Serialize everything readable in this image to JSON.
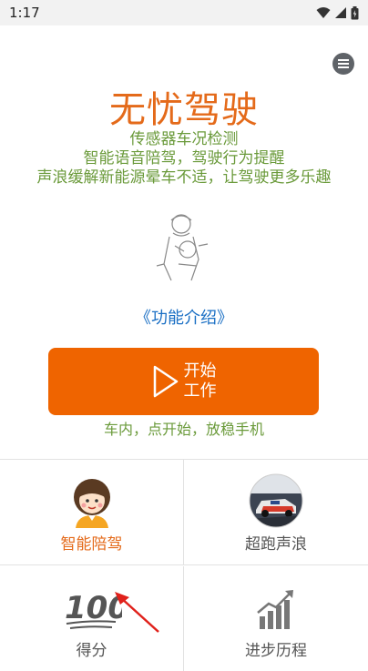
{
  "status_bar": {
    "time": "1:17"
  },
  "app": {
    "title": "无忧驾驶",
    "taglines": [
      "传感器车况检测",
      "智能语音陪驾，驾驶行为提醒",
      "声浪缓解新能源晕车不适，让驾驶更多乐趣"
    ],
    "feature_link": "《功能介绍》",
    "start_button": "开始\n工作",
    "start_hint": "车内，点开始，放稳手机"
  },
  "grid": {
    "items": [
      {
        "label": "智能陪驾",
        "icon": "girl-avatar-icon"
      },
      {
        "label": "超跑声浪",
        "icon": "sports-car-icon"
      },
      {
        "label": "得分",
        "icon": "score-100-icon"
      },
      {
        "label": "进步历程",
        "icon": "progress-chart-icon"
      }
    ]
  },
  "colors": {
    "title": "#e46a1a",
    "accent_green": "#6a9a3a",
    "button": "#ef6400",
    "link": "#1a6fc4"
  }
}
